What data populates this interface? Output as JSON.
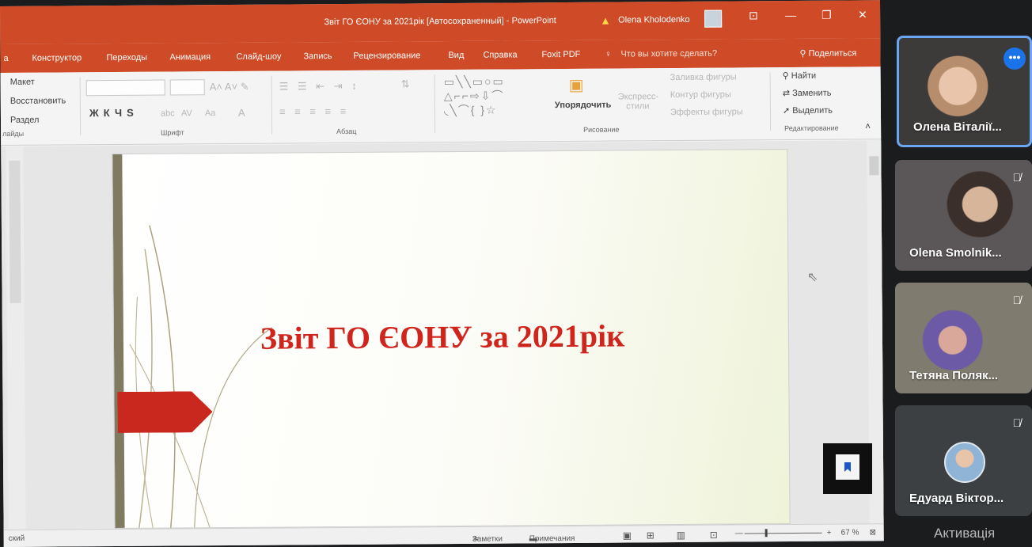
{
  "window": {
    "title": "Звіт ГО ЄОНУ за 2021рік [Автосохраненный] - PowerPoint",
    "user": "Olena Kholodenko"
  },
  "ribbon_tabs": [
    "а",
    "Конструктор",
    "Переходы",
    "Анимация",
    "Слайд-шоу",
    "Запись",
    "Рецензирование",
    "Вид",
    "Справка",
    "Foxit PDF"
  ],
  "tell_me": "Что вы хотите сделать?",
  "share": "Поделиться",
  "ribbon": {
    "slides_group": {
      "layout": "Макет",
      "reset": "Восстановить",
      "section": "Раздел",
      "label": "лайды"
    },
    "font_group": {
      "label": "Шрифт",
      "bold": "Ж",
      "italic": "К",
      "underline": "Ч",
      "shadow": "S",
      "strike": "abc",
      "spacing": "AV",
      "case": "Aa",
      "color": "A"
    },
    "paragraph_group": {
      "label": "Абзац"
    },
    "drawing_group": {
      "label": "Рисование",
      "arrange": "Упорядочить",
      "quick_styles": "Экспресс-стили",
      "fill": "Заливка фигуры",
      "outline": "Контур фигуры",
      "effects": "Эффекты фигуры"
    },
    "editing_group": {
      "label": "Редактирование",
      "find": "Найти",
      "replace": "Заменить",
      "select": "Выделить"
    }
  },
  "slide": {
    "title": "Звіт ГО ЄОНУ за 2021рік"
  },
  "statusbar": {
    "language": "ский",
    "notes": "Заметки",
    "comments": "Примечания",
    "zoom": "67 %"
  },
  "participants": [
    {
      "name": "Олена Віталії...",
      "muted": false
    },
    {
      "name": "Olena Smolnik...",
      "muted": true
    },
    {
      "name": "Тетяна Поляк...",
      "muted": true
    },
    {
      "name": "Едуард Віктор...",
      "muted": true
    }
  ],
  "activation": "Активація"
}
